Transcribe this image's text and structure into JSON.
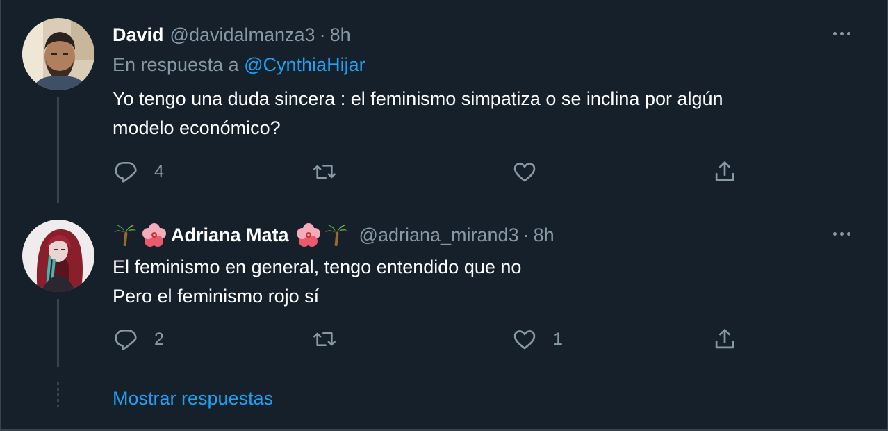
{
  "tweets": [
    {
      "display_name": "David",
      "handle": "@davidalmanza3",
      "separator": "·",
      "time": "8h",
      "replying_prefix": "En respuesta a",
      "replying_to": "@CynthiaHijar",
      "text_lines": [
        "Yo tengo una duda sincera : el feminismo simpatiza o se inclina por algún",
        "modelo económico?"
      ],
      "reply_count": "4",
      "retweet_count": "",
      "like_count": ""
    },
    {
      "display_name": "Adriana Mata",
      "name_emojis": [
        "palm-tree",
        "hibiscus",
        "hibiscus",
        "palm-tree"
      ],
      "handle": "@adriana_mirand3",
      "separator": "·",
      "time": "8h",
      "text_lines": [
        "El feminismo en general, tengo entendido que no",
        "Pero el feminismo rojo sí"
      ],
      "reply_count": "2",
      "retweet_count": "",
      "like_count": "1"
    }
  ],
  "show_replies_label": "Mostrar respuestas",
  "icons": {
    "reply": "reply-icon",
    "retweet": "retweet-icon",
    "like": "heart-icon",
    "share": "share-icon",
    "more": "more-icon"
  },
  "colors": {
    "background": "#15202b",
    "secondary_text": "#8899a6",
    "link": "#1da1f2",
    "border": "#38444d"
  }
}
